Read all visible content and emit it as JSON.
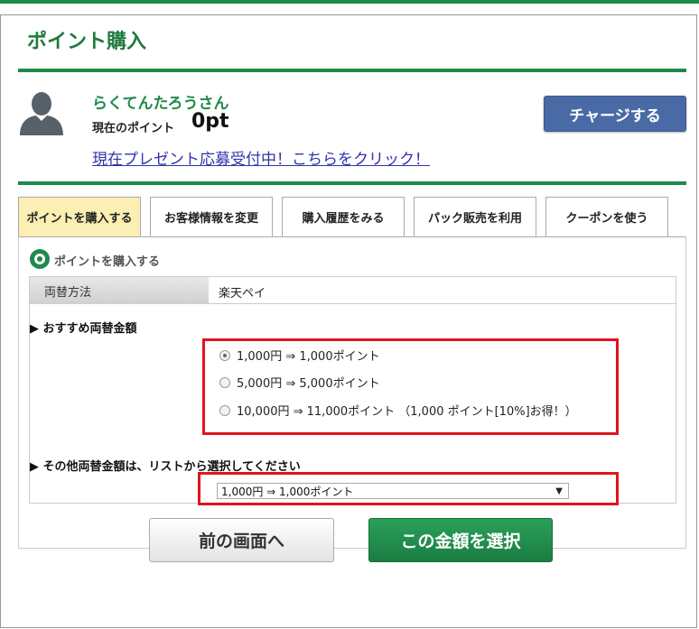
{
  "page": {
    "title": "ポイント購入"
  },
  "user": {
    "name": "らくてんたろうさん",
    "points_label": "現在のポイント",
    "points_value": "0pt",
    "present_link": "現在プレゼント応募受付中！こちらをクリック！",
    "charge_button": "チャージする"
  },
  "tabs": [
    {
      "label": "ポイントを購入する",
      "active": true
    },
    {
      "label": "お客様情報を変更",
      "active": false
    },
    {
      "label": "購入履歴をみる",
      "active": false
    },
    {
      "label": "パック販売を利用",
      "active": false
    },
    {
      "label": "クーポンを使う",
      "active": false
    }
  ],
  "section": {
    "title": "ポイントを購入する",
    "exchange_method_label": "両替方法",
    "exchange_method_value": "楽天ペイ",
    "recommended_heading": "▶ おすすめ両替金額",
    "options": [
      {
        "label": "1,000円 ⇒ 1,000ポイント",
        "checked": true
      },
      {
        "label": "5,000円 ⇒ 5,000ポイント",
        "checked": false
      },
      {
        "label": "10,000円 ⇒ 11,000ポイント （1,000 ポイント[10%]お得！）",
        "checked": false
      }
    ],
    "other_heading": "▶ その他両替金額は、リストから選択してください",
    "select_value": "1,000円 ⇒ 1,000ポイント",
    "select_arrow": "▼"
  },
  "buttons": {
    "back": "前の画面へ",
    "select_amount": "この金額を選択"
  },
  "colors": {
    "brand_green": "#1f8a4c",
    "charge_blue": "#4a6aa6",
    "highlight_red": "#e0141e",
    "active_tab": "#fbefb3"
  }
}
